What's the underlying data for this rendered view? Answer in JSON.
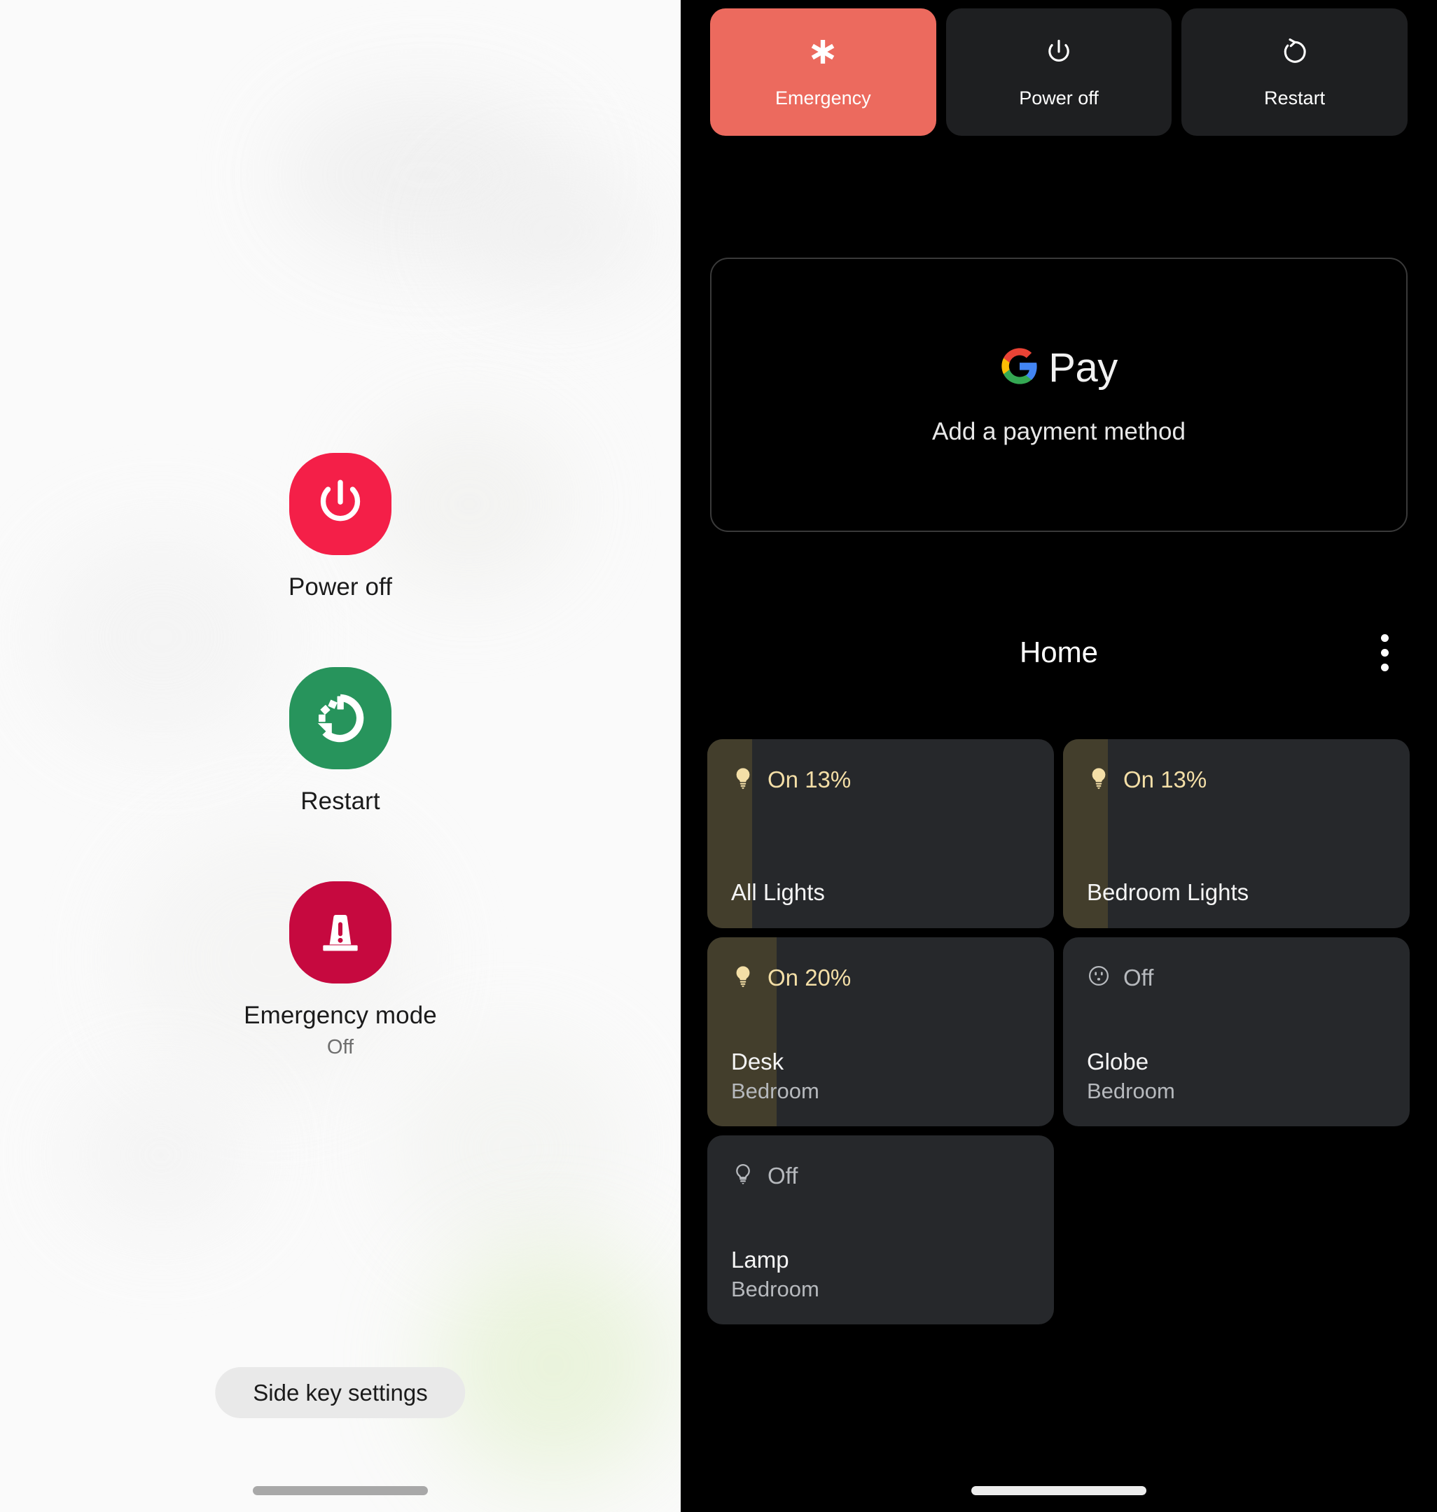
{
  "left_panel": {
    "menu_items": [
      {
        "icon": "power-off-icon",
        "label": "Power off",
        "sub": ""
      },
      {
        "icon": "restart-icon",
        "label": "Restart",
        "sub": ""
      },
      {
        "icon": "emergency-siren-icon",
        "label": "Emergency mode",
        "sub": "Off"
      }
    ],
    "side_key_button": "Side key settings"
  },
  "right_panel": {
    "power_actions": [
      {
        "icon": "asterisk-medical-icon",
        "label": "Emergency",
        "highlight_color": "#EC6A5E"
      },
      {
        "icon": "power-icon",
        "label": "Power off",
        "highlight_color": "#1E1F21"
      },
      {
        "icon": "restart-icon",
        "label": "Restart",
        "highlight_color": "#1E1F21"
      }
    ],
    "gpay": {
      "brand": "Pay",
      "prompt": "Add a payment method"
    },
    "home": {
      "title": "Home",
      "overflow_icon": "more-vertical-icon",
      "tiles": [
        {
          "icon": "bulb-filled-icon",
          "status": "On 13%",
          "state": "on",
          "fill_pct": 13,
          "name": "All Lights",
          "room": ""
        },
        {
          "icon": "bulb-filled-icon",
          "status": "On 13%",
          "state": "on",
          "fill_pct": 13,
          "name": "Bedroom Lights",
          "room": ""
        },
        {
          "icon": "bulb-filled-icon",
          "status": "On 20%",
          "state": "on",
          "fill_pct": 20,
          "name": "Desk",
          "room": "Bedroom"
        },
        {
          "icon": "outlet-icon",
          "status": "Off",
          "state": "off",
          "fill_pct": 0,
          "name": "Globe",
          "room": "Bedroom"
        },
        {
          "icon": "bulb-outline-icon",
          "status": "Off",
          "state": "off",
          "fill_pct": 0,
          "name": "Lamp",
          "room": "Bedroom"
        }
      ]
    }
  },
  "colors": {
    "samsung_red": "#F41F48",
    "samsung_green": "#27945C",
    "samsung_crimson": "#C6093F",
    "emergency_coral": "#EC6A5E",
    "tile_bg": "#26282B",
    "tile_fill": "#433E2C",
    "on_yellow": "#F4DFA7",
    "off_grey": "#B6B9BD"
  }
}
